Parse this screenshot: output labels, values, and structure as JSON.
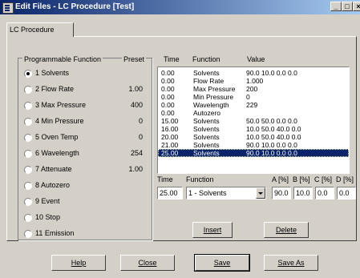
{
  "window": {
    "title": "Edit Files - LC Procedure [Test]",
    "min_glyph": "_",
    "max_glyph": "□",
    "close_glyph": "×"
  },
  "tab": {
    "label": "LC Procedure"
  },
  "functions_panel": {
    "header_function": "Programmable Function",
    "header_preset": "Preset",
    "items": [
      {
        "label": "1 Solvents",
        "preset": "",
        "checked": true
      },
      {
        "label": "2 Flow Rate",
        "preset": "1.00",
        "checked": false
      },
      {
        "label": "3 Max Pressure",
        "preset": "400",
        "checked": false
      },
      {
        "label": "4 Min Pressure",
        "preset": "0",
        "checked": false
      },
      {
        "label": "5 Oven Temp",
        "preset": "0",
        "checked": false
      },
      {
        "label": "6 Wavelength",
        "preset": "254",
        "checked": false
      },
      {
        "label": "7 Attenuate",
        "preset": "1.00",
        "checked": false
      },
      {
        "label": "8 Autozero",
        "preset": "",
        "checked": false
      },
      {
        "label": "9 Event",
        "preset": "",
        "checked": false
      },
      {
        "label": "10 Stop",
        "preset": "",
        "checked": false
      },
      {
        "label": "11 Emission",
        "preset": "",
        "checked": false
      }
    ]
  },
  "table": {
    "header_time": "Time",
    "header_function": "Function",
    "header_value": "Value",
    "rows": [
      {
        "time": "0.00",
        "function": "Solvents",
        "value": "90.0  10.0  0.0  0.0",
        "selected": false
      },
      {
        "time": "0.00",
        "function": "Flow Rate",
        "value": "1.000",
        "selected": false
      },
      {
        "time": "0.00",
        "function": "Max Pressure",
        "value": "200",
        "selected": false
      },
      {
        "time": "0.00",
        "function": "Min Pressure",
        "value": "0",
        "selected": false
      },
      {
        "time": "0.00",
        "function": "Wavelength",
        "value": "229",
        "selected": false
      },
      {
        "time": "0.00",
        "function": "Autozero",
        "value": "",
        "selected": false
      },
      {
        "time": "15.00",
        "function": "Solvents",
        "value": "50.0  50.0  0.0  0.0",
        "selected": false
      },
      {
        "time": "16.00",
        "function": "Solvents",
        "value": "10.0  50.0  40.0  0.0",
        "selected": false
      },
      {
        "time": "20.00",
        "function": "Solvents",
        "value": "10.0  50.0  40.0  0.0",
        "selected": false
      },
      {
        "time": "21.00",
        "function": "Solvents",
        "value": "90.0  10.0  0.0  0.0",
        "selected": false
      },
      {
        "time": "25.00",
        "function": "Solvents",
        "value": "90.0  10.0  0.0  0.0",
        "selected": true
      }
    ]
  },
  "editor": {
    "time_label": "Time",
    "function_label": "Function",
    "a_label": "A [%]",
    "b_label": "B [%]",
    "c_label": "C [%]",
    "d_label": "D [%]",
    "time_value": "25.00",
    "function_value": "1 - Solvents",
    "a_value": "90.0",
    "b_value": "10.0",
    "c_value": "0.0",
    "d_value": "0.0"
  },
  "buttons": {
    "insert": "Insert",
    "delete": "Delete",
    "help": "Help",
    "close": "Close",
    "save": "Save",
    "save_as": "Save As"
  }
}
